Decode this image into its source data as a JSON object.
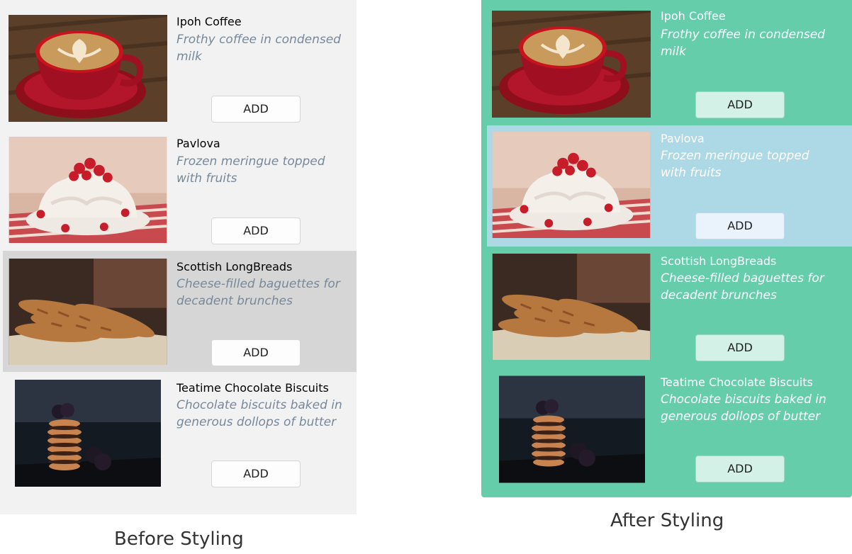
{
  "captions": {
    "before": "Before Styling",
    "after": "After Styling"
  },
  "colors": {
    "before_bg": "#f2f2f2",
    "before_selected": "#d6d6d6",
    "after_bg": "#66cdaa",
    "after_selected": "#add8e6",
    "desc_before": "#77889a"
  },
  "items": [
    {
      "name": "Ipoh Coffee",
      "description": "Frothy coffee in condensed milk",
      "button": "ADD",
      "image": "coffee-cup-photo"
    },
    {
      "name": "Pavlova",
      "description": "Frozen meringue topped with fruits",
      "button": "ADD",
      "image": "pavlova-photo"
    },
    {
      "name": "Scottish LongBreads",
      "description": "Cheese-filled baguettes for decadent brunches",
      "button": "ADD",
      "image": "baguettes-photo"
    },
    {
      "name": "Teatime Chocolate Biscuits",
      "description": "Chocolate biscuits baked in generous dollops of butter",
      "button": "ADD",
      "image": "chocolate-biscuits-photo"
    }
  ],
  "selected": {
    "before": 2,
    "after": 1
  }
}
